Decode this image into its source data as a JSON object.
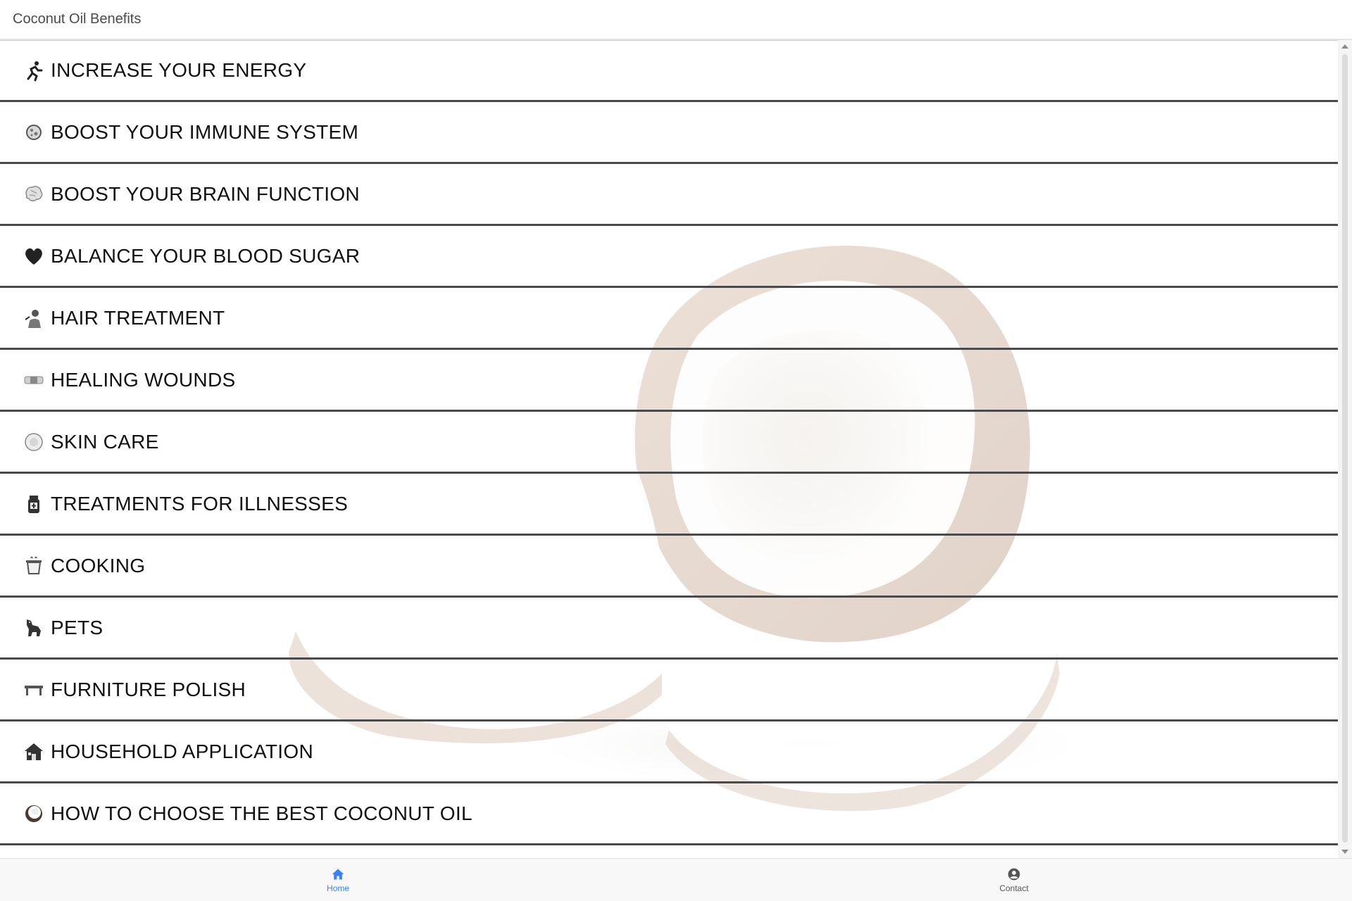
{
  "app": {
    "title": "Coconut Oil Benefits"
  },
  "menu": {
    "items": [
      {
        "label": "INCREASE YOUR ENERGY",
        "icon": "runner-icon"
      },
      {
        "label": "BOOST YOUR IMMUNE SYSTEM",
        "icon": "virus-icon"
      },
      {
        "label": "BOOST YOUR BRAIN FUNCTION",
        "icon": "brain-icon"
      },
      {
        "label": "BALANCE YOUR BLOOD SUGAR",
        "icon": "heart-icon"
      },
      {
        "label": "HAIR TREATMENT",
        "icon": "hair-salon-icon"
      },
      {
        "label": "HEALING WOUNDS",
        "icon": "bandage-icon"
      },
      {
        "label": "SKIN CARE",
        "icon": "skin-cream-icon"
      },
      {
        "label": "TREATMENTS FOR ILLNESSES",
        "icon": "medicine-bottle-icon"
      },
      {
        "label": "COOKING",
        "icon": "cooking-pot-icon"
      },
      {
        "label": "PETS",
        "icon": "dog-icon"
      },
      {
        "label": "FURNITURE POLISH",
        "icon": "table-icon"
      },
      {
        "label": "HOUSEHOLD APPLICATION",
        "icon": "house-icon"
      },
      {
        "label": "HOW TO CHOOSE THE BEST COCONUT OIL",
        "icon": "coconut-icon"
      }
    ]
  },
  "tabs": [
    {
      "label": "Home",
      "icon": "home-icon",
      "active": true
    },
    {
      "label": "Contact",
      "icon": "contact-icon",
      "active": false
    }
  ],
  "colors": {
    "accent": "#3880ff",
    "divider": "#4a4a4a",
    "text": "#111111"
  }
}
